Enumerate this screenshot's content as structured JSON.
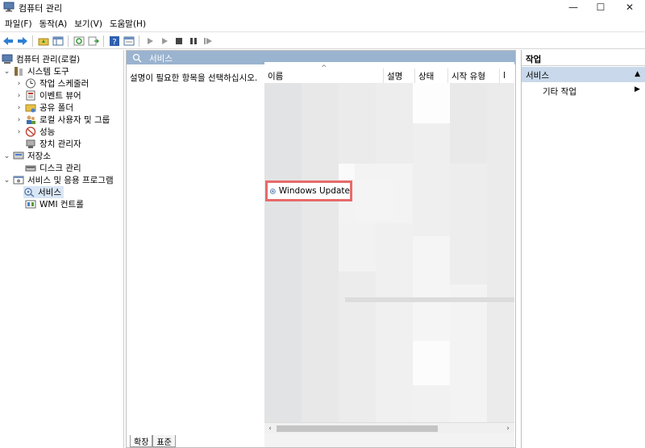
{
  "window": {
    "title": "컴퓨터 관리",
    "min_glyph": "—",
    "max_glyph": "☐",
    "close_glyph": "✕"
  },
  "menubar": {
    "items": [
      "파일(F)",
      "동작(A)",
      "보기(V)",
      "도움말(H)"
    ]
  },
  "tree": {
    "root": "컴퓨터 관리(로컬)",
    "system_tools": "시스템 도구",
    "task_scheduler": "작업 스케줄러",
    "event_viewer": "이벤트 뷰어",
    "shared_folders": "공유 폴더",
    "local_users": "로컬 사용자 및 그룹",
    "performance": "성능",
    "device_manager": "장치 관리자",
    "storage": "저장소",
    "disk_management": "디스크 관리",
    "services_apps": "서비스 및 응용 프로그램",
    "services": "서비스",
    "wmi": "WMI 컨트롤"
  },
  "middle": {
    "header_title": "서비스",
    "description_prompt": "설명이 필요한 항목을 선택하십시오.",
    "columns": [
      "이름",
      "설명",
      "상태",
      "시작 유형",
      "l"
    ],
    "highlighted_service": "Windows Update",
    "tabs": [
      "확장",
      "표준"
    ]
  },
  "actions": {
    "header": "작업",
    "section": "서비스",
    "more_actions": "기타 작업"
  },
  "colors": {
    "accent_header": "#9ab3cf",
    "highlight_border": "#e86a6a",
    "selected_row": "#c9d8ea"
  }
}
